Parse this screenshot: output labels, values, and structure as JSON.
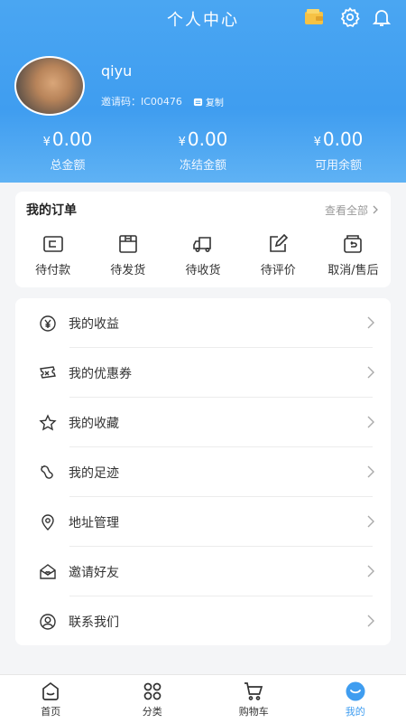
{
  "header": {
    "title": "个人中心",
    "icons": [
      "wallet-icon",
      "gear-icon",
      "bell-icon"
    ],
    "accent_color": "#3f9df0"
  },
  "profile": {
    "username": "qiyu",
    "invite_label": "邀请码：",
    "invite_code": "IC00476",
    "copy_label": "复制"
  },
  "balances": [
    {
      "currency": "¥",
      "amount": "0.00",
      "label": "总金额"
    },
    {
      "currency": "¥",
      "amount": "0.00",
      "label": "冻结金额"
    },
    {
      "currency": "¥",
      "amount": "0.00",
      "label": "可用余额"
    }
  ],
  "orders": {
    "title": "我的订单",
    "view_all": "查看全部",
    "items": [
      {
        "label": "待付款",
        "icon": "wallet-card-icon"
      },
      {
        "label": "待发货",
        "icon": "box-icon"
      },
      {
        "label": "待收货",
        "icon": "truck-icon"
      },
      {
        "label": "待评价",
        "icon": "edit-icon"
      },
      {
        "label": "取消/售后",
        "icon": "return-icon"
      }
    ]
  },
  "menu": {
    "items": [
      {
        "label": "我的收益",
        "icon": "yen-circle-icon"
      },
      {
        "label": "我的优惠券",
        "icon": "coupon-icon"
      },
      {
        "label": "我的收藏",
        "icon": "star-icon"
      },
      {
        "label": "我的足迹",
        "icon": "footprint-icon"
      },
      {
        "label": "地址管理",
        "icon": "location-icon"
      },
      {
        "label": "邀请好友",
        "icon": "mail-heart-icon"
      },
      {
        "label": "联系我们",
        "icon": "user-circle-icon"
      }
    ]
  },
  "bottom_nav": {
    "items": [
      {
        "label": "首页",
        "icon": "home-icon",
        "active": false
      },
      {
        "label": "分类",
        "icon": "category-icon",
        "active": false
      },
      {
        "label": "购物车",
        "icon": "cart-icon",
        "active": false
      },
      {
        "label": "我的",
        "icon": "profile-icon",
        "active": true
      }
    ]
  }
}
